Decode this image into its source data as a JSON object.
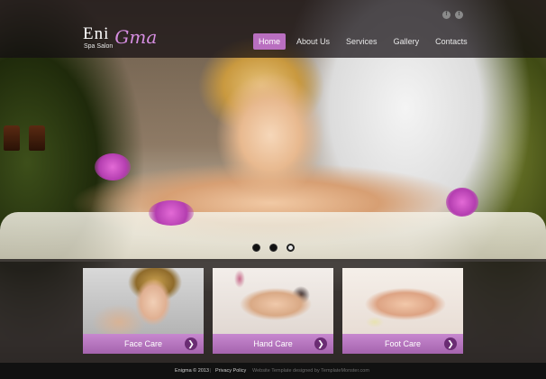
{
  "brand": {
    "name": "Eni",
    "script": "Gma",
    "tagline": "Spa Salon"
  },
  "social": [
    {
      "icon": "facebook-icon",
      "glyph": "f"
    },
    {
      "icon": "twitter-icon",
      "glyph": "t"
    }
  ],
  "nav": {
    "items": [
      {
        "label": "Home",
        "active": true
      },
      {
        "label": "About Us",
        "active": false
      },
      {
        "label": "Services",
        "active": false
      },
      {
        "label": "Gallery",
        "active": false
      },
      {
        "label": "Contacts",
        "active": false
      }
    ]
  },
  "slider": {
    "dot_count": 3,
    "active_index": 2
  },
  "services": [
    {
      "label": "Face Care"
    },
    {
      "label": "Hand Care"
    },
    {
      "label": "Foot Care"
    }
  ],
  "footer": {
    "copyright": "Enigma © 2013",
    "separator": "|",
    "privacy": "Privacy Policy",
    "credit": "Website Template designed by TemplateMonster.com"
  },
  "colors": {
    "accent": "#b96fc0",
    "card_bar": "#c788cf",
    "arrow": "#6a2c73"
  }
}
